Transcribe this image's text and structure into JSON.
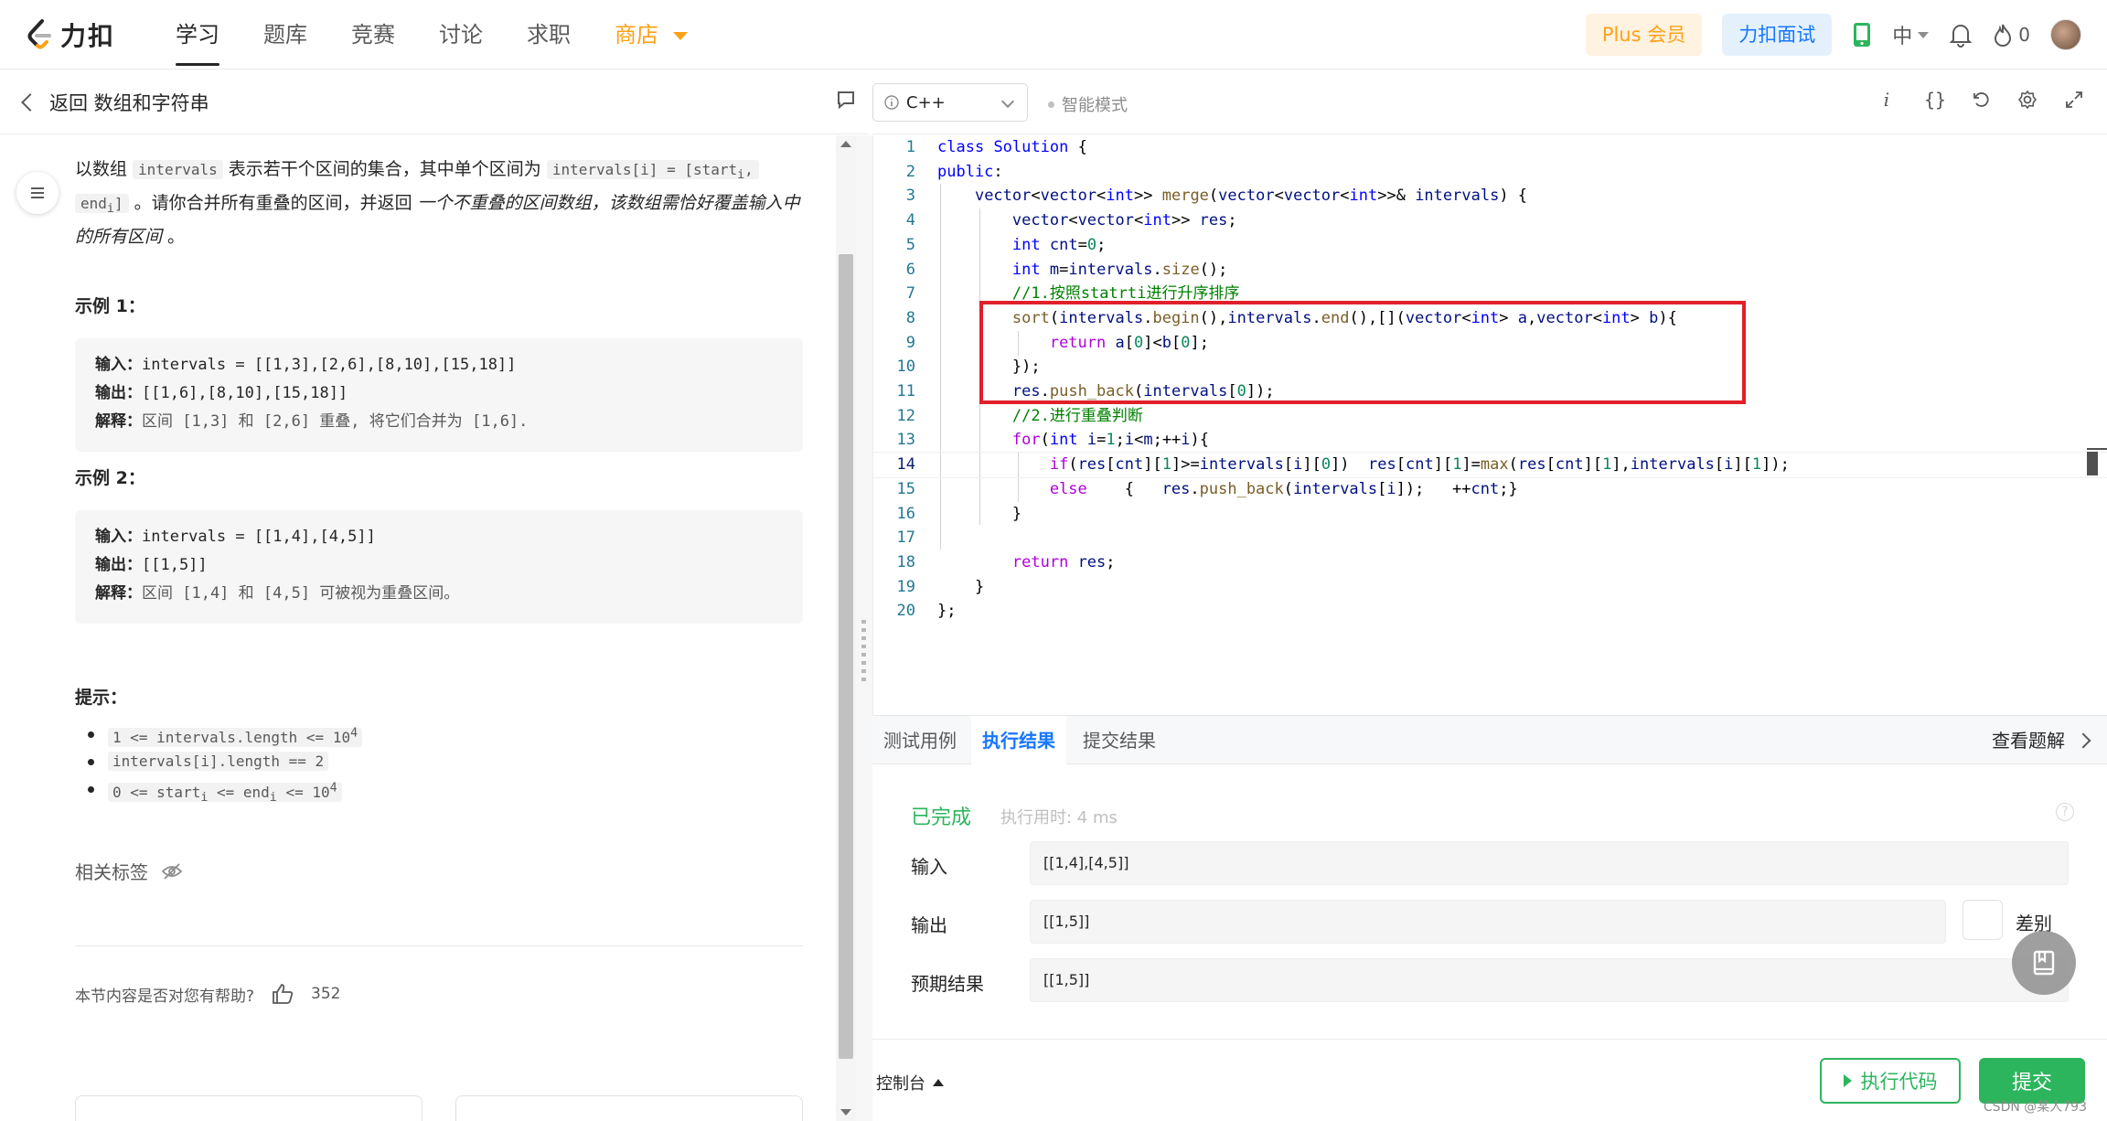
{
  "brand": {
    "name": "力扣"
  },
  "nav": {
    "items": [
      "学习",
      "题库",
      "竞赛",
      "讨论",
      "求职",
      "商店"
    ],
    "active": "学习",
    "plus_label": "Plus 会员",
    "interview_label": "力扣面试",
    "lang": "中",
    "fire_count": "0"
  },
  "left": {
    "back_label": "返回 数组和字符串",
    "desc": {
      "p1": "以数组 ",
      "c1": "intervals",
      "p2": " 表示若干个区间的集合，其中单个区间为 ",
      "c2": "intervals[i] = [start",
      "c2_sub": "i",
      "c2_end": ",",
      "c3": "end",
      "c3_sub": "i",
      "c3_end": "]",
      "p3": " 。请你合并所有重叠的区间，并返回 ",
      "em": "一个不重叠的区间数组，该数组需恰好覆盖输入中的所有区间",
      "p4": " 。"
    },
    "ex1": {
      "title": "示例 1：",
      "in_k": "输入：",
      "in_v": "intervals = [[1,3],[2,6],[8,10],[15,18]]",
      "out_k": "输出：",
      "out_v": "[[1,6],[8,10],[15,18]]",
      "exp_k": "解释：",
      "exp_v": "区间 [1,3] 和 [2,6] 重叠, 将它们合并为 [1,6]."
    },
    "ex2": {
      "title": "示例 2：",
      "in_k": "输入：",
      "in_v": "intervals = [[1,4],[4,5]]",
      "out_k": "输出：",
      "out_v": "[[1,5]]",
      "exp_k": "解释：",
      "exp_v": "区间 [1,4] 和 [4,5] 可被视为重叠区间。"
    },
    "tips_title": "提示：",
    "tips": [
      {
        "a": "1 <= intervals.length <= 10",
        "sup": "4"
      },
      {
        "a": "intervals[i].length == 2",
        "sup": ""
      },
      {
        "a": "0 <= start",
        "sub": "i",
        "b": " <= end",
        "sub2": "i",
        "c": " <= 10",
        "sup": "4"
      }
    ],
    "tags_label": "相关标签",
    "helpful_label": "本节内容是否对您有帮助?",
    "like_count": "352"
  },
  "editor": {
    "language": "C++",
    "mode": "智能模式",
    "current_line": 14
  },
  "console": {
    "tabs": [
      "测试用例",
      "执行结果",
      "提交结果"
    ],
    "active_tab": "执行结果",
    "view_solution": "查看题解",
    "status": "已完成",
    "exec_time": "执行用时: 4 ms",
    "input_label": "输入",
    "input_value": "[[1,4],[4,5]]",
    "output_label": "输出",
    "output_value": "[[1,5]]",
    "diff_label": "差别",
    "expected_label": "预期结果",
    "expected_value": "[[1,5]]"
  },
  "bottom": {
    "console_label": "控制台",
    "run_label": "执行代码",
    "submit_label": "提交",
    "watermark": "CSDN @某人793"
  },
  "colors": {
    "accent_orange": "#ffa116",
    "accent_blue": "#1677ff",
    "success_green": "#2db55d",
    "highlight_red": "#e0202a"
  }
}
